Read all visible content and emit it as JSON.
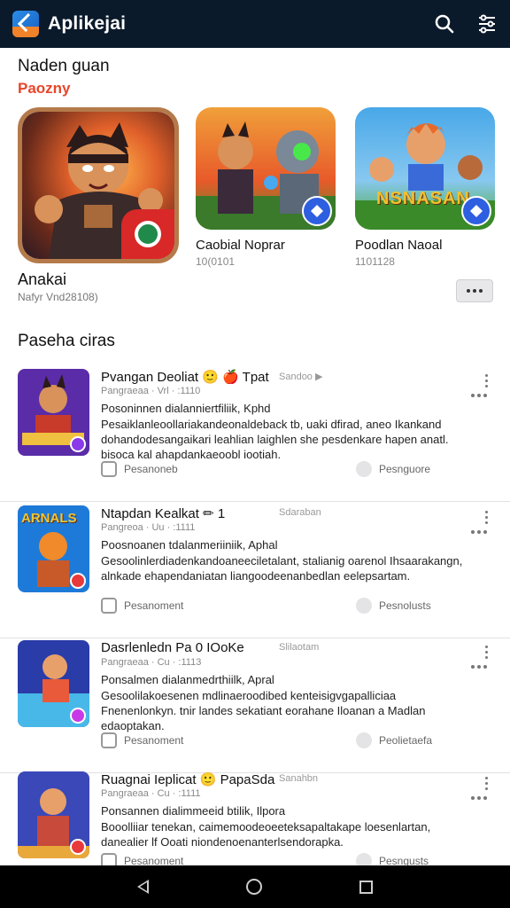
{
  "app": {
    "title": "Aplikejai",
    "icons": [
      "search-icon",
      "filter-icon"
    ]
  },
  "section1": {
    "title": "Naden guan",
    "subtitle": "Paozny",
    "featured": {
      "title": "Anakai",
      "meta": "Nafyr Vnd28108)"
    },
    "cards": [
      {
        "title": "Caobial Noprar",
        "meta": "10(0101"
      },
      {
        "title": "Poodlan Naoal",
        "meta": "1101128",
        "banner": "NSNASAN"
      }
    ]
  },
  "section2": {
    "title": "Paseha ciras",
    "items": [
      {
        "title": "Pvangan Deoliat 🙂 🍎 Tpat",
        "tag": "Sandoo ▶",
        "meta": "Pangraeaa · Vrl · :1110",
        "headline": "Posoninnen dialanniertfiliik, Kphd",
        "desc": "Pesaiklanleoollariakandeonaldeback tb, uaki dfirad, aneo Ikankand dohandodesangaikari leahlian laighlen she pesdenkare hapen anatl. bisoca kal ahapdankaeoobl iootiah.",
        "action1": "Pesanoneb",
        "action2": "Pesnguore",
        "thumb_colors": [
          "#5a2ca8",
          "#c83a2a",
          "#f0c040"
        ]
      },
      {
        "title": "Ntapdan Kealkat ✏ 1",
        "tag": "Sdaraban",
        "meta": "Pangreoa · Uu · :1111",
        "headline": "Poosnoanen tdalanmeriiniik, Aphal",
        "desc": "Gesoolinlerdiadenkandoaneeciletalant, stalianig oarenol Ihsaarakangn, alnkade ehapendaniatan liangoodeenanbedlan eelepsartam.",
        "action1": "Pesanoment",
        "action2": "Pesnolusts",
        "thumb_colors": [
          "#1e7ad8",
          "#f08a2a",
          "#e8c83a"
        ],
        "banner": "ARNALS"
      },
      {
        "title": "Dasrlenledn Pa 0 IOoKe",
        "tag": "Slilaotam",
        "meta": "Pangraeaa · Cu · :1113",
        "headline": "Ponsalmen dialanmedrthiilk, Apral",
        "desc": "Gesoolilakoesenen mdlinaeroodibed kenteisigvgapalliciaa Fnenenlonkyn. tnir landes sekatiant eorahane Iloanan a Madlan edaoptakan.",
        "action1": "Pesanoment",
        "action2": "Peolietaefa",
        "thumb_colors": [
          "#2a3ca8",
          "#e85a3a",
          "#48b8e8"
        ]
      },
      {
        "title": "Ruagnai Ieplicat 🙂 PapaSda",
        "tag": "Sanahbn",
        "meta": "Pangraeaa · Cu · :1111",
        "headline": "Ponsannen dialimmeeid btilik, Ilpora",
        "desc": "Booolliiar tenekan, caimemoodeoeeteksapaltakape loesenlartan, danealier lf Ooati niondenoenanterlsendorapka.",
        "action1": "Pesanoment",
        "action2": "Pesngusts",
        "thumb_colors": [
          "#3a48b8",
          "#c84a3a",
          "#e8a83a"
        ]
      }
    ]
  },
  "navbar": {
    "icons": [
      "back-icon",
      "home-icon",
      "recents-icon"
    ]
  }
}
